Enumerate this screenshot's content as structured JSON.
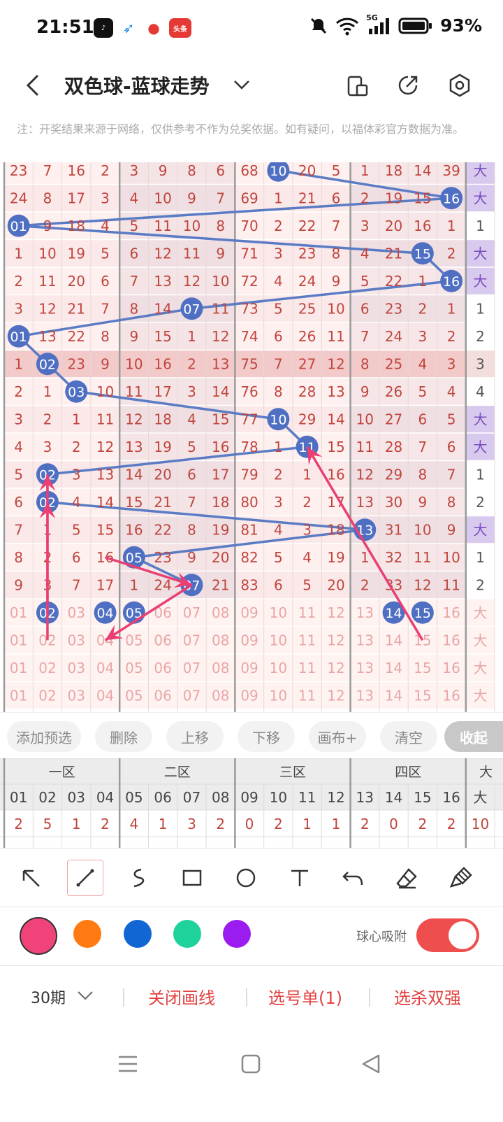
{
  "status_bar": {
    "time": "21:51",
    "battery": "93%",
    "network": "5G",
    "app_badge": "头条"
  },
  "header": {
    "title": "双色球-蓝球走势"
  },
  "notice": "注：开奖结果来源于网络，仅供参考不作为兑奖依据。如有疑问，以福体彩官方数据为准。",
  "chart_data": {
    "type": "table",
    "columns": [
      "01",
      "02",
      "03",
      "04",
      "05",
      "06",
      "07",
      "08",
      "09",
      "10",
      "11",
      "12",
      "13",
      "14",
      "15",
      "16",
      "大"
    ],
    "rows": [
      {
        "hit": 10,
        "cells": [
          "23",
          "7",
          "16",
          "2",
          "3",
          "9",
          "8",
          "6",
          "68",
          "10",
          "20",
          "5",
          "1",
          "18",
          "14",
          "39",
          "大"
        ]
      },
      {
        "hit": 16,
        "cells": [
          "24",
          "8",
          "17",
          "3",
          "4",
          "10",
          "9",
          "7",
          "69",
          "1",
          "21",
          "6",
          "2",
          "19",
          "15",
          "16",
          "大"
        ]
      },
      {
        "hit": 1,
        "cells": [
          "01",
          "9",
          "18",
          "4",
          "5",
          "11",
          "10",
          "8",
          "70",
          "2",
          "22",
          "7",
          "3",
          "20",
          "16",
          "1",
          "1"
        ]
      },
      {
        "hit": 15,
        "cells": [
          "1",
          "10",
          "19",
          "5",
          "6",
          "12",
          "11",
          "9",
          "71",
          "3",
          "23",
          "8",
          "4",
          "21",
          "15",
          "2",
          "大"
        ]
      },
      {
        "hit": 16,
        "cells": [
          "2",
          "11",
          "20",
          "6",
          "7",
          "13",
          "12",
          "10",
          "72",
          "4",
          "24",
          "9",
          "5",
          "22",
          "1",
          "16",
          "大"
        ]
      },
      {
        "hit": 7,
        "cells": [
          "3",
          "12",
          "21",
          "7",
          "8",
          "14",
          "07",
          "11",
          "73",
          "5",
          "25",
          "10",
          "6",
          "23",
          "2",
          "1",
          "1"
        ]
      },
      {
        "hit": 1,
        "cells": [
          "01",
          "13",
          "22",
          "8",
          "9",
          "15",
          "1",
          "12",
          "74",
          "6",
          "26",
          "11",
          "7",
          "24",
          "3",
          "2",
          "2"
        ]
      },
      {
        "hit": 2,
        "cells": [
          "1",
          "02",
          "23",
          "9",
          "10",
          "16",
          "2",
          "13",
          "75",
          "7",
          "27",
          "12",
          "8",
          "25",
          "4",
          "3",
          "3"
        ]
      },
      {
        "hit": 3,
        "cells": [
          "2",
          "1",
          "03",
          "10",
          "11",
          "17",
          "3",
          "14",
          "76",
          "8",
          "28",
          "13",
          "9",
          "26",
          "5",
          "4",
          "4"
        ]
      },
      {
        "hit": 10,
        "cells": [
          "3",
          "2",
          "1",
          "11",
          "12",
          "18",
          "4",
          "15",
          "77",
          "10",
          "29",
          "14",
          "10",
          "27",
          "6",
          "5",
          "大"
        ]
      },
      {
        "hit": 11,
        "cells": [
          "4",
          "3",
          "2",
          "12",
          "13",
          "19",
          "5",
          "16",
          "78",
          "1",
          "11",
          "15",
          "11",
          "28",
          "7",
          "6",
          "大"
        ]
      },
      {
        "hit": 2,
        "cells": [
          "5",
          "02",
          "3",
          "13",
          "14",
          "20",
          "6",
          "17",
          "79",
          "2",
          "1",
          "16",
          "12",
          "29",
          "8",
          "7",
          "1"
        ]
      },
      {
        "hit": 2,
        "cells": [
          "6",
          "02",
          "4",
          "14",
          "15",
          "21",
          "7",
          "18",
          "80",
          "3",
          "2",
          "17",
          "13",
          "30",
          "9",
          "8",
          "2"
        ]
      },
      {
        "hit": 13,
        "cells": [
          "7",
          "1",
          "5",
          "15",
          "16",
          "22",
          "8",
          "19",
          "81",
          "4",
          "3",
          "18",
          "13",
          "31",
          "10",
          "9",
          "大"
        ]
      },
      {
        "hit": 5,
        "cells": [
          "8",
          "2",
          "6",
          "16",
          "05",
          "23",
          "9",
          "20",
          "82",
          "5",
          "4",
          "19",
          "1",
          "32",
          "11",
          "10",
          "1"
        ]
      },
      {
        "hit": 7,
        "cells": [
          "9",
          "3",
          "7",
          "17",
          "1",
          "24",
          "07",
          "21",
          "83",
          "6",
          "5",
          "20",
          "2",
          "33",
          "12",
          "11",
          "2"
        ]
      }
    ],
    "pick_rows": [
      {
        "selected": [
          2,
          4,
          5,
          14,
          15
        ],
        "cells": [
          "01",
          "02",
          "03",
          "04",
          "05",
          "06",
          "07",
          "08",
          "09",
          "10",
          "11",
          "12",
          "13",
          "14",
          "15",
          "16",
          "大"
        ]
      },
      {
        "selected": [],
        "cells": [
          "01",
          "02",
          "03",
          "04",
          "05",
          "06",
          "07",
          "08",
          "09",
          "10",
          "11",
          "12",
          "13",
          "14",
          "15",
          "16",
          "大"
        ]
      },
      {
        "selected": [],
        "cells": [
          "01",
          "02",
          "03",
          "04",
          "05",
          "06",
          "07",
          "08",
          "09",
          "10",
          "11",
          "12",
          "13",
          "14",
          "15",
          "16",
          "大"
        ]
      },
      {
        "selected": [],
        "cells": [
          "01",
          "02",
          "03",
          "04",
          "05",
          "06",
          "07",
          "08",
          "09",
          "10",
          "11",
          "12",
          "13",
          "14",
          "15",
          "16",
          "大"
        ]
      }
    ],
    "colors": {
      "line": "#5b7bc4",
      "ball": "#4f6fc2",
      "arrow": "#ea3f72",
      "cell_text": "#c0453d",
      "pick_text": "#e8a6a6",
      "big_bg": "#d8c9ee"
    }
  },
  "toolbar": {
    "buttons": [
      "添加预选",
      "删除",
      "上移",
      "下移",
      "画布+",
      "清空"
    ],
    "collapse": "收起"
  },
  "summary": {
    "zones": [
      "一区",
      "二区",
      "三区",
      "四区",
      "大"
    ],
    "headers": [
      "01",
      "02",
      "03",
      "04",
      "05",
      "06",
      "07",
      "08",
      "09",
      "10",
      "11",
      "12",
      "13",
      "14",
      "15",
      "16",
      "大"
    ],
    "counts": [
      "2",
      "5",
      "1",
      "2",
      "4",
      "1",
      "3",
      "2",
      "0",
      "2",
      "1",
      "1",
      "2",
      "0",
      "2",
      "2",
      "10"
    ]
  },
  "draw_tools": {
    "items": [
      "arrow-tool",
      "line-tool",
      "curve-tool",
      "rect-tool",
      "circle-tool",
      "text-tool",
      "undo-tool",
      "eraser-tool",
      "brush-tool"
    ],
    "active": "line-tool"
  },
  "palette": {
    "colors": [
      "#f0437a",
      "#ff7a12",
      "#1166d4",
      "#1ed39b",
      "#9a1cf0"
    ],
    "snap_label": "球心吸附",
    "snap_on": true
  },
  "bottom_bar": {
    "period": "30期",
    "close_lines": "关闭画线",
    "ticket": "选号单(1)",
    "pick_strong": "选杀双强"
  }
}
